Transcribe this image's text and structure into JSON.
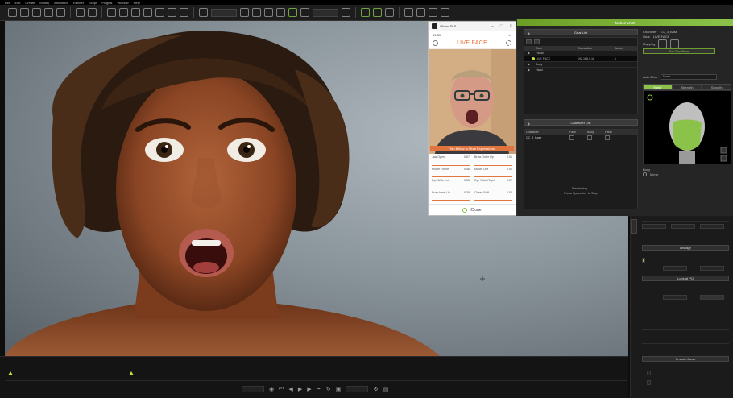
{
  "phone": {
    "title": "iPhone™ S...",
    "time": "19:39",
    "brand": "LIVE FACE",
    "banner": "Tap Below to Mute Expressions",
    "footer": "iClone",
    "readouts": [
      {
        "label": "Jaw Open",
        "value": "0.67"
      },
      {
        "label": "Brow Outer Up",
        "value": "0.51"
      },
      {
        "label": "Mouth Funnel",
        "value": "0.46"
      },
      {
        "label": "Mouth Left",
        "value": "0.02"
      },
      {
        "label": "Eye Wide Left",
        "value": "0.55"
      },
      {
        "label": "Eye Wide Right",
        "value": "0.57"
      },
      {
        "label": "Brow Inner Up",
        "value": "0.38"
      },
      {
        "label": "Cheek Puff",
        "value": "0.04"
      }
    ]
  },
  "motion_live": {
    "title": "Motion LIVE",
    "gear_list": {
      "title": "Gear List",
      "columns": [
        "",
        "Gear",
        "Connection",
        "Action"
      ],
      "rows": [
        {
          "name": "Facial",
          "connection": "",
          "action": ""
        },
        {
          "name": "LIVE FACE",
          "connection": "192.168.0.18",
          "action": "1"
        },
        {
          "name": "Body",
          "connection": "",
          "action": ""
        },
        {
          "name": "Hand",
          "connection": "",
          "action": ""
        }
      ]
    },
    "character_list": {
      "title": "Character List",
      "columns": [
        "Character",
        "Face",
        "Body",
        "Hand"
      ],
      "rows": [
        {
          "name": "CC_3_Base"
        }
      ],
      "status_line1": "Previewing...",
      "status_line2": "Press Space key to Stop"
    },
    "right": {
      "character_label": "Character",
      "character_value": "CC_3_Base",
      "gear_label": "Gear",
      "gear_value": "LIVE FACE",
      "mapping_label": "Mapping",
      "set_zero_button": "Set Zero Pose",
      "auto_blink_label": "Auto Blink",
      "auto_blink_value": "None",
      "tabs": [
        "Mask",
        "Strength",
        "Smooth"
      ],
      "body_label": "Body",
      "mirror_label": "Mirror"
    }
  },
  "right_panel": {
    "linkage": "Linkage",
    "look_at": "Look at VO",
    "smooth_mesh": "Smooth Mesh"
  },
  "menu": [
    "File",
    "Edit",
    "Create",
    "Modify",
    "Animation",
    "Render",
    "Script",
    "Plugins",
    "Window",
    "Help"
  ],
  "colors": {
    "accent": "#8bc34a",
    "phone_accent": "#e8723a"
  }
}
